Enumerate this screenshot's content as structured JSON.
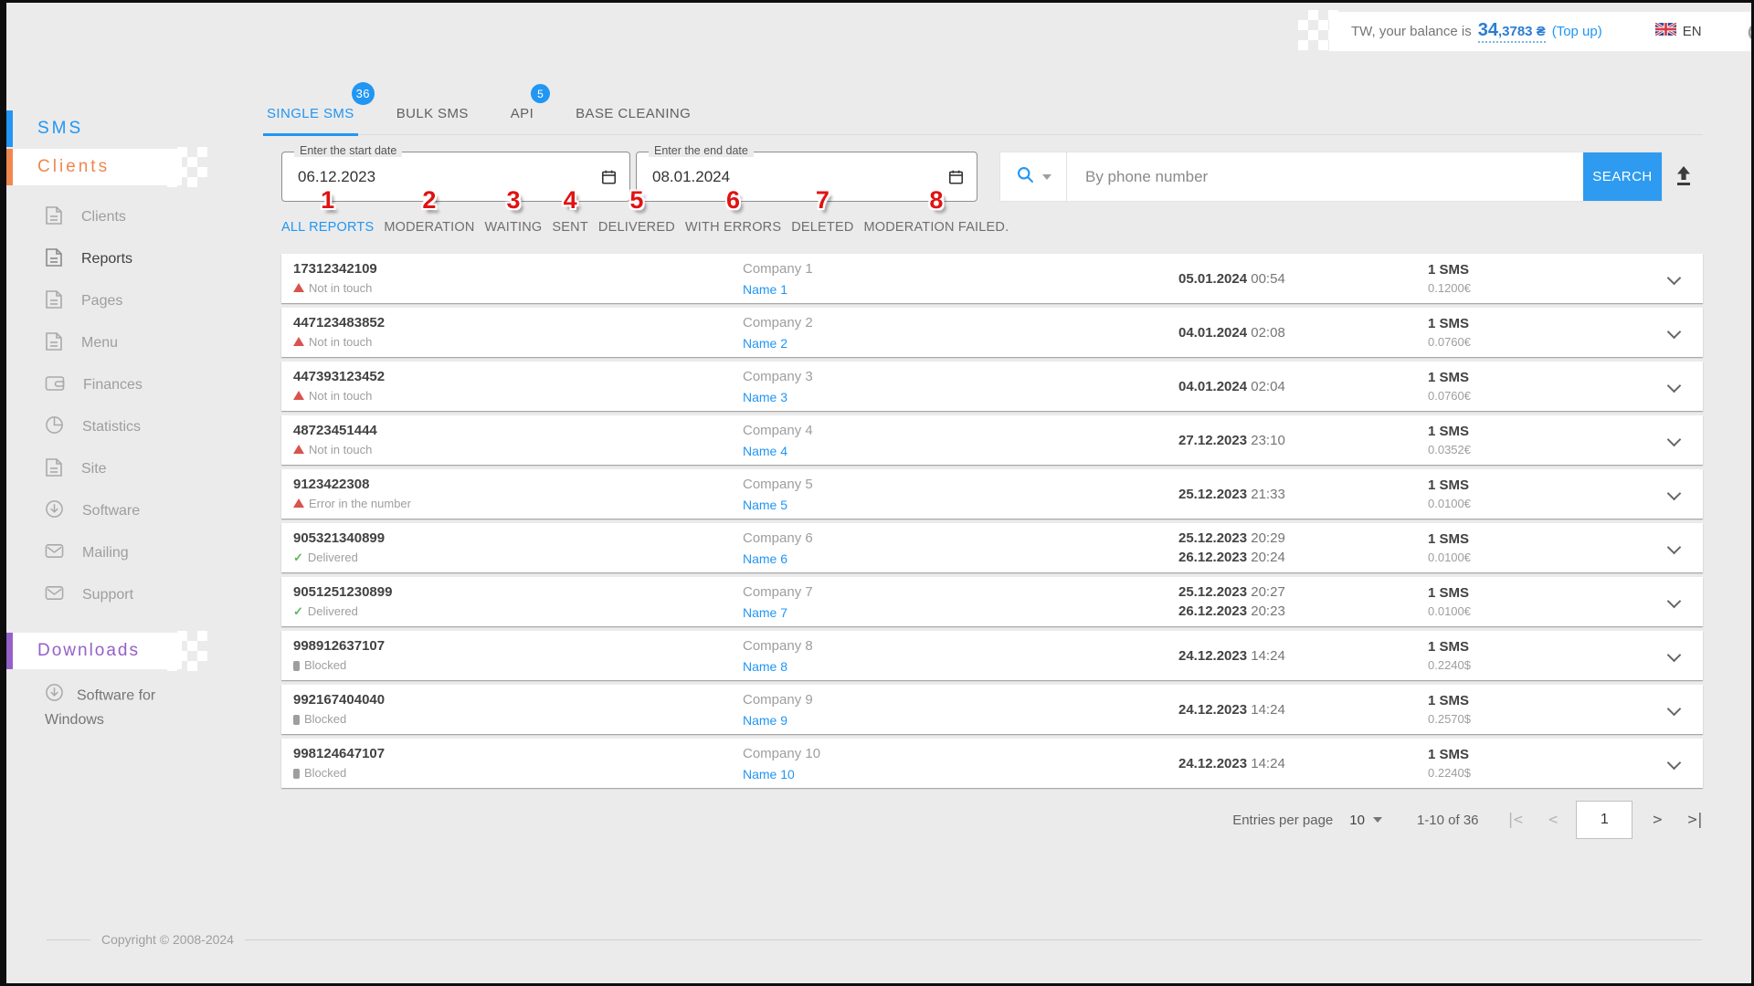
{
  "colors": {
    "accent": "#2196f3",
    "orange": "#f0874f",
    "purple": "#9560c8",
    "annotation_red": "#e01313",
    "error_red": "#d9534f",
    "success_green": "#5cb85c"
  },
  "topbar": {
    "balance_prefix": "TW, your balance is",
    "balance_int": "34",
    "balance_fraction": ",3783",
    "currency": "₴",
    "top_up": "(Top up)",
    "language": "EN"
  },
  "sidebar": {
    "sms_section": "SMS",
    "clients_section": "Clients",
    "downloads_section": "Downloads",
    "items": [
      "Clients",
      "Reports",
      "Pages",
      "Menu",
      "Finances",
      "Statistics",
      "Site",
      "Software",
      "Mailing",
      "Support"
    ],
    "software_for_windows": "Software for Windows"
  },
  "footer": {
    "copyright": "Copyright © 2008-2024"
  },
  "tabs": [
    {
      "label": "SINGLE SMS",
      "badge": "36"
    },
    {
      "label": "BULK SMS"
    },
    {
      "label": "API",
      "badge": "5"
    },
    {
      "label": "BASE CLEANING"
    }
  ],
  "date_filters": {
    "start_label": "Enter the start date",
    "start_value": "06.12.2023",
    "end_label": "Enter the end date",
    "end_value": "08.01.2024"
  },
  "status_filters": [
    {
      "num": "1",
      "label": "ALL REPORTS"
    },
    {
      "num": "2",
      "label": "MODERATION"
    },
    {
      "num": "3",
      "label": "WAITING"
    },
    {
      "num": "4",
      "label": "SENT"
    },
    {
      "num": "5",
      "label": "DELIVERED"
    },
    {
      "num": "6",
      "label": "WITH ERRORS"
    },
    {
      "num": "7",
      "label": "DELETED"
    },
    {
      "num": "8",
      "label": "MODERATION FAILED."
    }
  ],
  "search": {
    "placeholder": "By phone number",
    "button": "SEARCH"
  },
  "table": {
    "rows": [
      {
        "phone": "17312342109",
        "status": "Not in touch",
        "company": "Company 1",
        "name": "Name 1",
        "date1": "05.01.2024",
        "time1": "00:54",
        "sms": "1 SMS",
        "price": "0.1200€"
      },
      {
        "phone": "447123483852",
        "status": "Not in touch",
        "company": "Company 2",
        "name": "Name 2",
        "date1": "04.01.2024",
        "time1": "02:08",
        "sms": "1 SMS",
        "price": "0.0760€"
      },
      {
        "phone": "447393123452",
        "status": "Not in touch",
        "company": "Company 3",
        "name": "Name 3",
        "date1": "04.01.2024",
        "time1": "02:04",
        "sms": "1 SMS",
        "price": "0.0760€"
      },
      {
        "phone": "48723451444",
        "status": "Not in touch",
        "company": "Company 4",
        "name": "Name 4",
        "date1": "27.12.2023",
        "time1": "23:10",
        "sms": "1 SMS",
        "price": "0.0352€"
      },
      {
        "phone": "9123422308",
        "status": "Error in the number",
        "company": "Company 5",
        "name": "Name 5",
        "date1": "25.12.2023",
        "time1": "21:33",
        "sms": "1 SMS",
        "price": "0.0100€"
      },
      {
        "phone": "905321340899",
        "status": "Delivered",
        "company": "Company 6",
        "name": "Name 6",
        "date1": "25.12.2023",
        "time1": "20:29",
        "date2": "26.12.2023",
        "time2": "20:24",
        "sms": "1 SMS",
        "price": "0.0100€"
      },
      {
        "phone": "9051251230899",
        "status": "Delivered",
        "company": "Company 7",
        "name": "Name 7",
        "date1": "25.12.2023",
        "time1": "20:27",
        "date2": "26.12.2023",
        "time2": "20:23",
        "sms": "1 SMS",
        "price": "0.0100€"
      },
      {
        "phone": "998912637107",
        "status": "Blocked",
        "company": "Company 8",
        "name": "Name 8",
        "date1": "24.12.2023",
        "time1": "14:24",
        "sms": "1 SMS",
        "price": "0.2240$"
      },
      {
        "phone": "992167404040",
        "status": "Blocked",
        "company": "Company 9",
        "name": "Name 9",
        "date1": "24.12.2023",
        "time1": "14:24",
        "sms": "1 SMS",
        "price": "0.2570$"
      },
      {
        "phone": "998124647107",
        "status": "Blocked",
        "company": "Company 10",
        "name": "Name 10",
        "date1": "24.12.2023",
        "time1": "14:24",
        "sms": "1 SMS",
        "price": "0.2240$"
      }
    ]
  },
  "pagination": {
    "entries_label": "Entries per page",
    "per_page": "10",
    "range": "1-10 of 36",
    "page": "1",
    "first": "|<",
    "prev": "<",
    "next": ">",
    "last": ">|"
  }
}
